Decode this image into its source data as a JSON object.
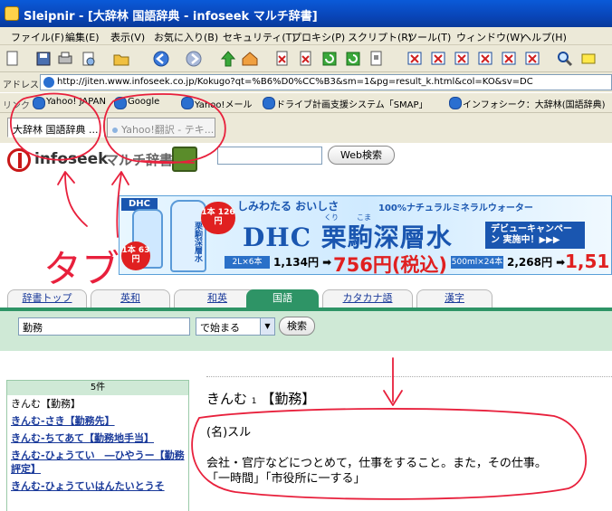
{
  "window": {
    "title": "Sleipnir - [大辞林 国語辞典 - infoseek マルチ辞書]"
  },
  "menu": [
    "ファイル(F)",
    "編集(E)",
    "表示(V)",
    "お気に入り(B)",
    "セキュリティ(T)",
    "プロキシ(P)",
    "スクリプト(R)",
    "ツール(T)",
    "ウィンドウ(W)",
    "ヘルプ(H)"
  ],
  "address": {
    "label": "アドレス",
    "url": "http://jiten.www.infoseek.co.jp/Kokugo?qt=%B6%D0%CC%B3&sm=1&pg=result_k.html&col=KO&sv=DC"
  },
  "links": {
    "label": "リンク",
    "items": [
      "Yahoo! JAPAN",
      "Google",
      "Yahoo!メール",
      "ドライブ計画支援システム「SMAP」",
      "インフォシーク：大辞林(国語辞典)"
    ]
  },
  "tabs": [
    {
      "label": "大辞林 国語辞典 ..."
    },
    {
      "label": "Yahoo!翻訳 - テキ..."
    }
  ],
  "site": {
    "brand": "infoseek",
    "sub": "マルチ辞書",
    "web_search": "Web検索"
  },
  "ad": {
    "logo": "DHC",
    "tagline": "しみわたる おいしさ",
    "tagline2": "100%ナチュラルミネラルウォーター",
    "headline": "DHC 栗駒深層水",
    "ruby1": "くり",
    "ruby2": "こま",
    "bottle_label": "栗駒深層水",
    "price1": "1本 63円",
    "price2": "1本 126円",
    "campaign": "デビューキャンペーン 実施中！▶▶▶",
    "offer1_label": "2L×6本",
    "offer1_price": "1,134円 ➡",
    "offer1_big": "756円(税込)",
    "offer2_label": "500ml×24本",
    "offer2_price": "2,268円 ➡",
    "offer2_big": "1,51"
  },
  "nav": [
    "辞書トップ",
    "英和",
    "和英",
    "国語",
    "カタカナ語",
    "漢字"
  ],
  "search": {
    "query": "勤務",
    "mode": "で始まる",
    "button": "検索"
  },
  "results": {
    "count": "5件",
    "items": [
      {
        "text": "きんむ【勤務】",
        "link": false
      },
      {
        "text": "きんむ‐さき【勤務先】",
        "link": true
      },
      {
        "text": "きんむ‐ちてあて【勤務地手当】",
        "link": true
      },
      {
        "text": "きんむ‐ひょうてい　―ひやうー【勤務評定】",
        "link": true
      },
      {
        "text": "きんむ‐ひょうていはんたいとうそ",
        "link": true
      }
    ]
  },
  "entry": {
    "headword": "きんむ",
    "number": "1",
    "kanji": "【勤務】",
    "pos": "(名)スル",
    "definition": "会社・官庁などにつとめて，仕事をすること。また，その仕事。",
    "examples": "「一時間」「市役所に一する」"
  },
  "annotation": {
    "text": "タブ",
    "color": "#e8203c"
  }
}
